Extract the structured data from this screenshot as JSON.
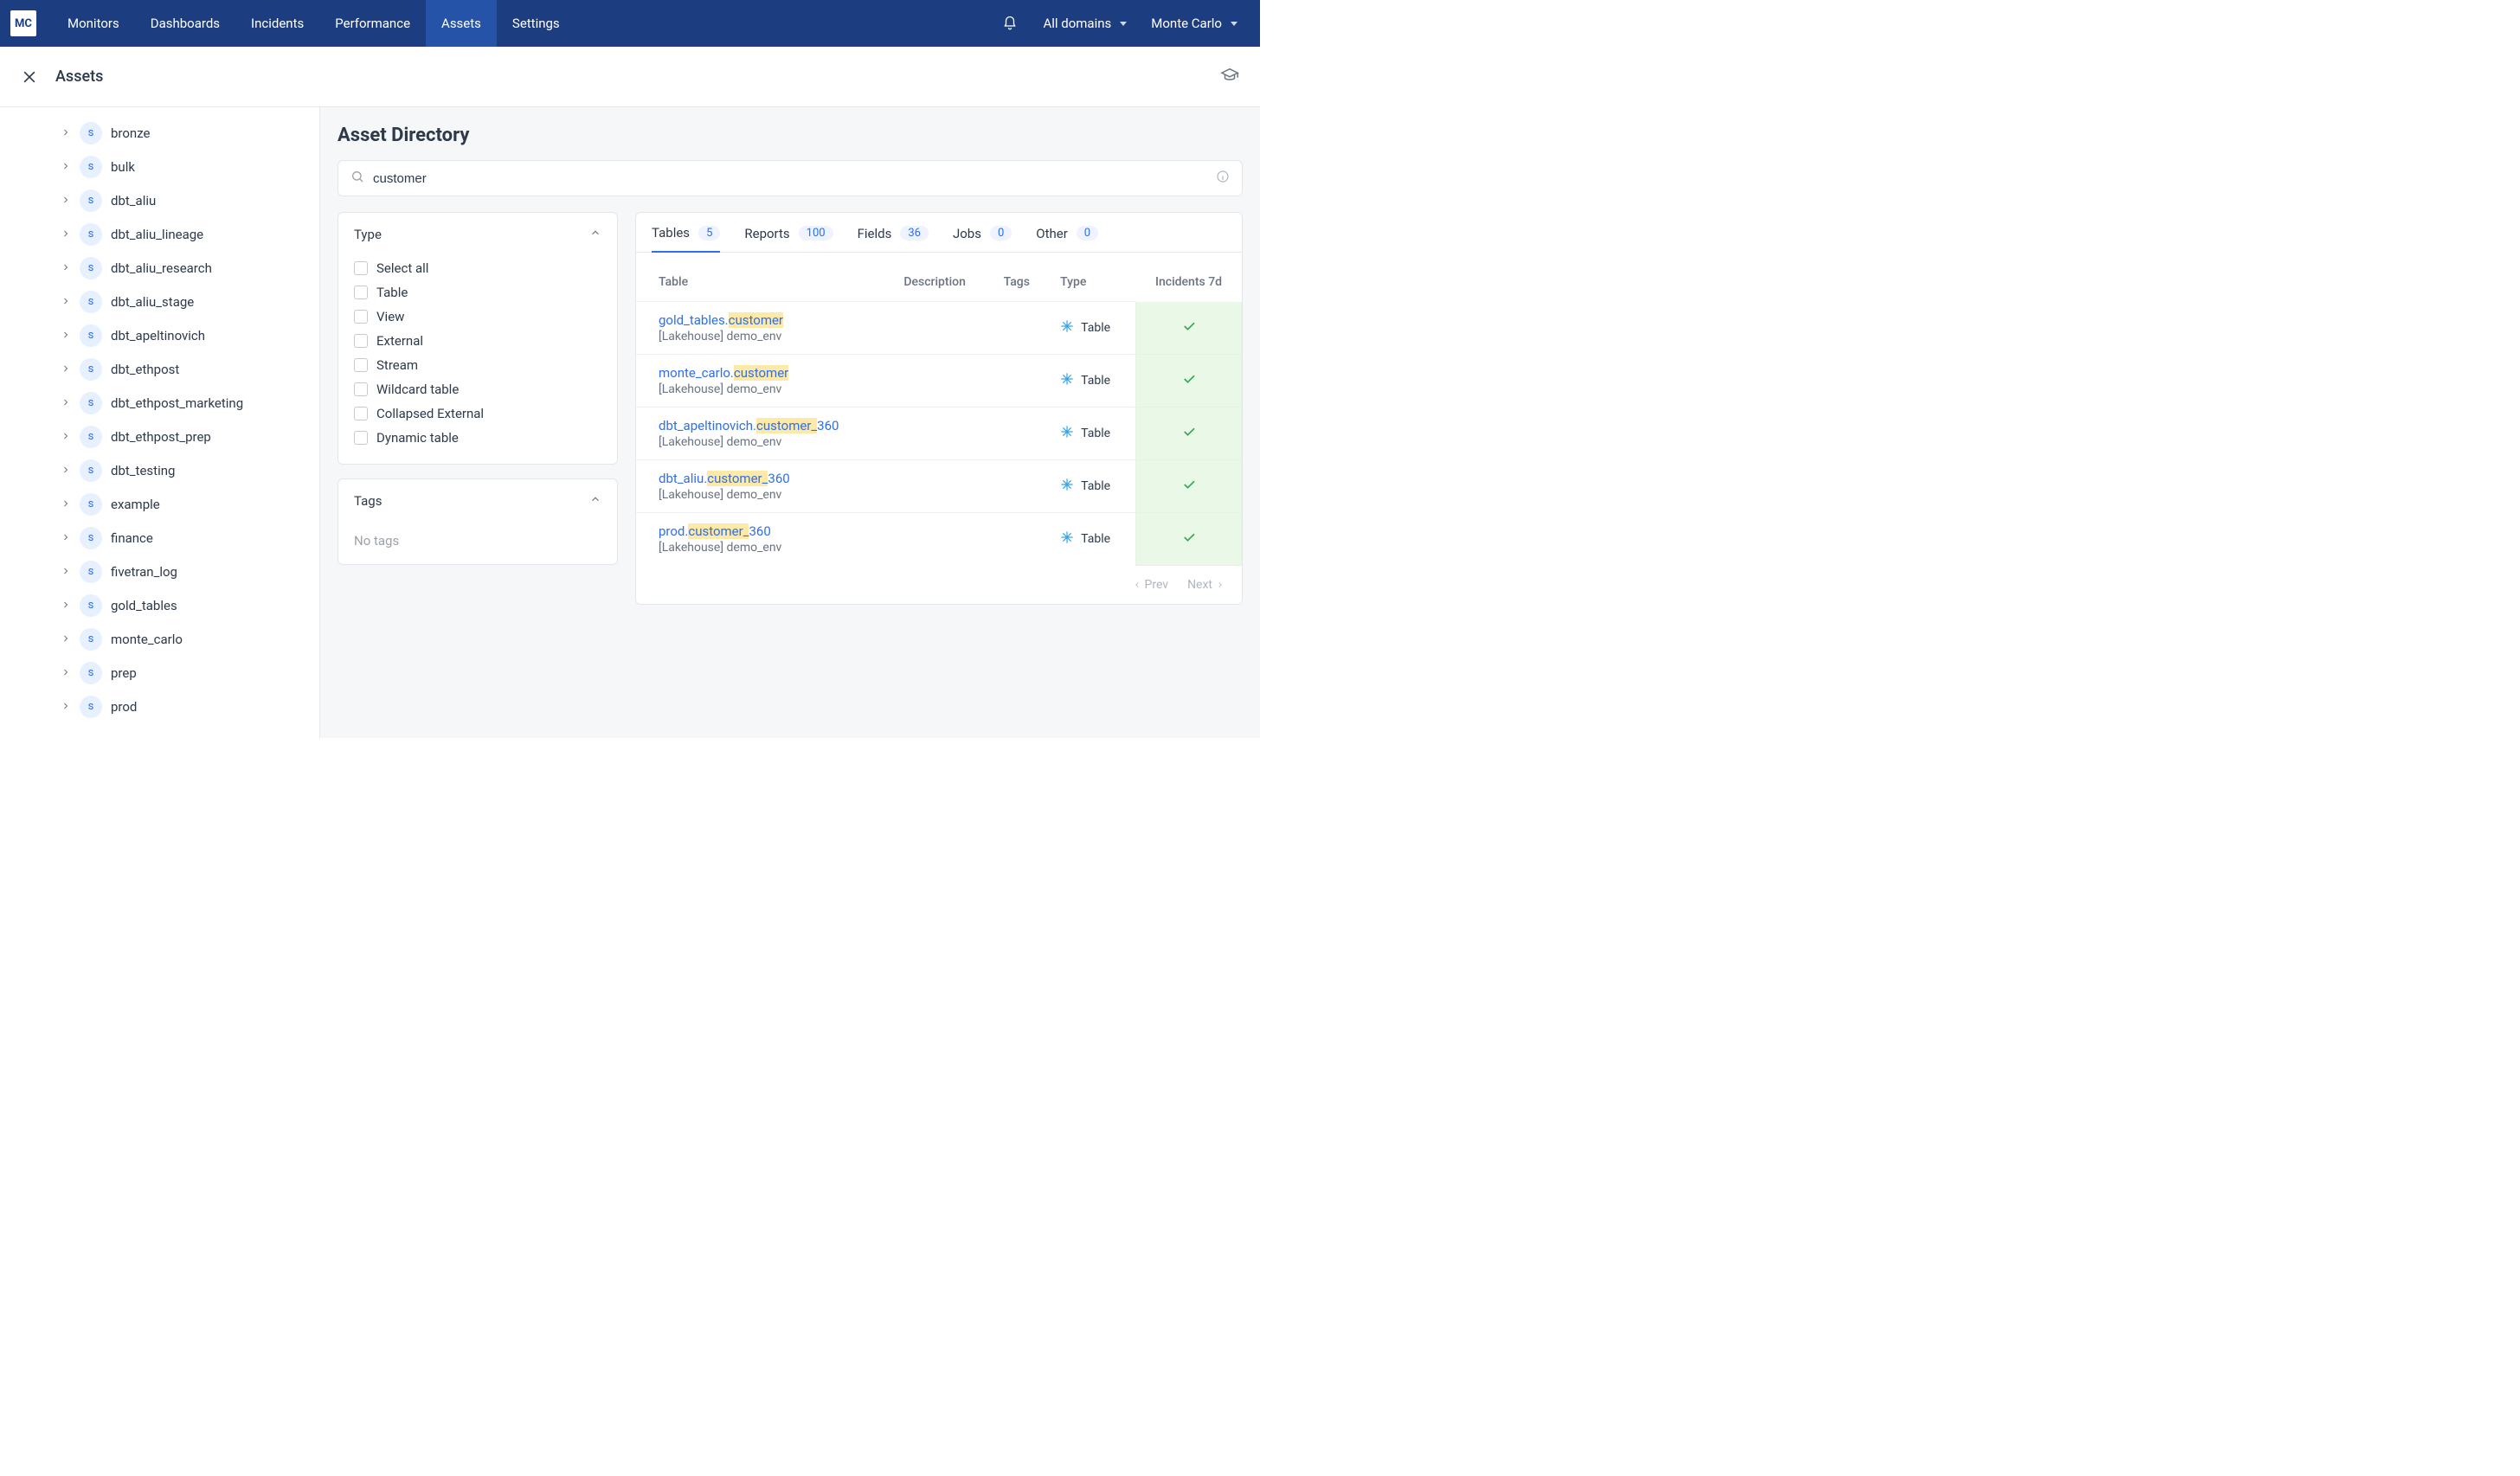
{
  "brand": "MC",
  "nav": {
    "items": [
      "Monitors",
      "Dashboards",
      "Incidents",
      "Performance",
      "Assets",
      "Settings"
    ],
    "active_index": 4,
    "domain_selector": "All domains",
    "user_name": "Monte Carlo"
  },
  "page": {
    "title": "Assets",
    "heading": "Asset Directory"
  },
  "sidebar": {
    "items": [
      "bronze",
      "bulk",
      "dbt_aliu",
      "dbt_aliu_lineage",
      "dbt_aliu_research",
      "dbt_aliu_stage",
      "dbt_apeltinovich",
      "dbt_ethpost",
      "dbt_ethpost_marketing",
      "dbt_ethpost_prep",
      "dbt_testing",
      "example",
      "finance",
      "fivetran_log",
      "gold_tables",
      "monte_carlo",
      "prep",
      "prod"
    ]
  },
  "search": {
    "value": "customer"
  },
  "filters": {
    "type": {
      "label": "Type",
      "options": [
        "Select all",
        "Table",
        "View",
        "External",
        "Stream",
        "Wildcard table",
        "Collapsed External",
        "Dynamic table"
      ]
    },
    "tags": {
      "label": "Tags",
      "empty_text": "No tags"
    }
  },
  "tabs": [
    {
      "label": "Tables",
      "count": 5
    },
    {
      "label": "Reports",
      "count": 100
    },
    {
      "label": "Fields",
      "count": 36
    },
    {
      "label": "Jobs",
      "count": 0
    },
    {
      "label": "Other",
      "count": 0
    }
  ],
  "active_tab_index": 0,
  "columns": {
    "table": "Table",
    "description": "Description",
    "tags": "Tags",
    "type": "Type",
    "incidents": "Incidents 7d"
  },
  "rows": [
    {
      "prefix": "gold_tables.",
      "highlight": "customer",
      "suffix": "",
      "sub": "[Lakehouse] demo_env",
      "type": "Table"
    },
    {
      "prefix": "monte_carlo.",
      "highlight": "customer",
      "suffix": "",
      "sub": "[Lakehouse] demo_env",
      "type": "Table"
    },
    {
      "prefix": "dbt_apeltinovich.",
      "highlight": "customer_",
      "suffix": "360",
      "sub": "[Lakehouse] demo_env",
      "type": "Table"
    },
    {
      "prefix": "dbt_aliu.",
      "highlight": "customer_",
      "suffix": "360",
      "sub": "[Lakehouse] demo_env",
      "type": "Table"
    },
    {
      "prefix": "prod.",
      "highlight": "customer_",
      "suffix": "360",
      "sub": "[Lakehouse] demo_env",
      "type": "Table"
    }
  ],
  "pager": {
    "prev": "Prev",
    "next": "Next"
  }
}
